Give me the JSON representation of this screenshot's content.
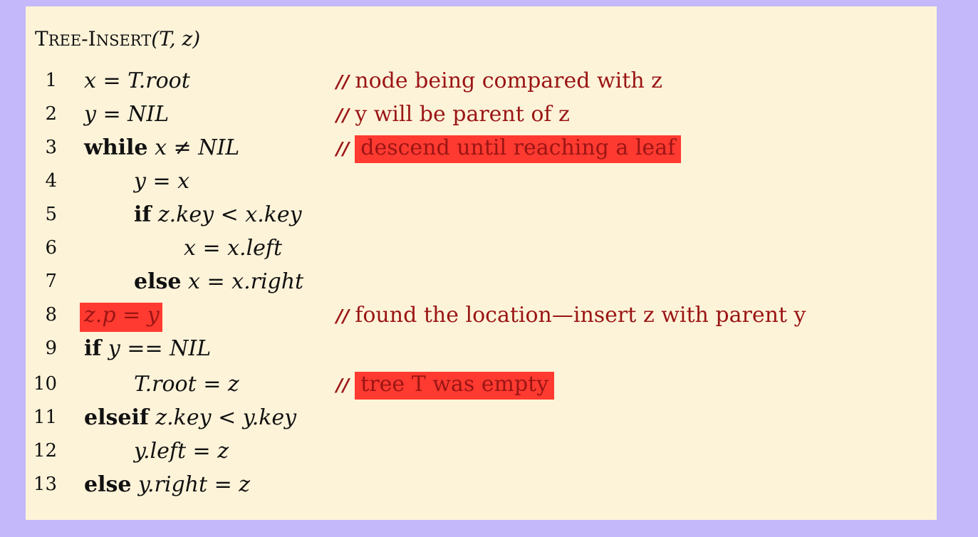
{
  "procedure": {
    "name_first_big": "T",
    "name_first_small": "REE",
    "name_dash": "-",
    "name_second_big": "I",
    "name_second_small": "NSERT",
    "params": "(T, z)"
  },
  "lines": [
    {
      "num": "1",
      "code": "x = T.root",
      "comment": "node being compared with z",
      "highlight": false
    },
    {
      "num": "2",
      "code": "y = NIL",
      "comment": "y will be parent of z",
      "highlight": false
    },
    {
      "num": "3",
      "keyword": "while",
      "code": "x ≠ NIL",
      "comment": "descend until reaching a leaf",
      "highlight": true
    },
    {
      "num": "4",
      "code": "y = x"
    },
    {
      "num": "5",
      "keyword": "if",
      "code": "z.key < x.key"
    },
    {
      "num": "6",
      "code": "x = x.left"
    },
    {
      "num": "7",
      "keyword": "else",
      "code": "x = x.right"
    },
    {
      "num": "8",
      "code": "z.p = y",
      "code_highlight": true,
      "comment": "found the location—insert z with parent y",
      "highlight": false
    },
    {
      "num": "9",
      "keyword": "if",
      "code": "y == NIL"
    },
    {
      "num": "10",
      "code": "T.root = z",
      "comment": "tree T was empty",
      "highlight": true
    },
    {
      "num": "11",
      "keyword": "elseif",
      "code": "z.key < y.key"
    },
    {
      "num": "12",
      "code": "y.left = z"
    },
    {
      "num": "13",
      "keyword": "else",
      "code": "y.right = z"
    }
  ],
  "comment_marker": "//",
  "colors": {
    "background": "#c4b8fa",
    "panel": "#fdf3d9",
    "comment": "#9a1515",
    "highlight": "#ff3a30"
  }
}
